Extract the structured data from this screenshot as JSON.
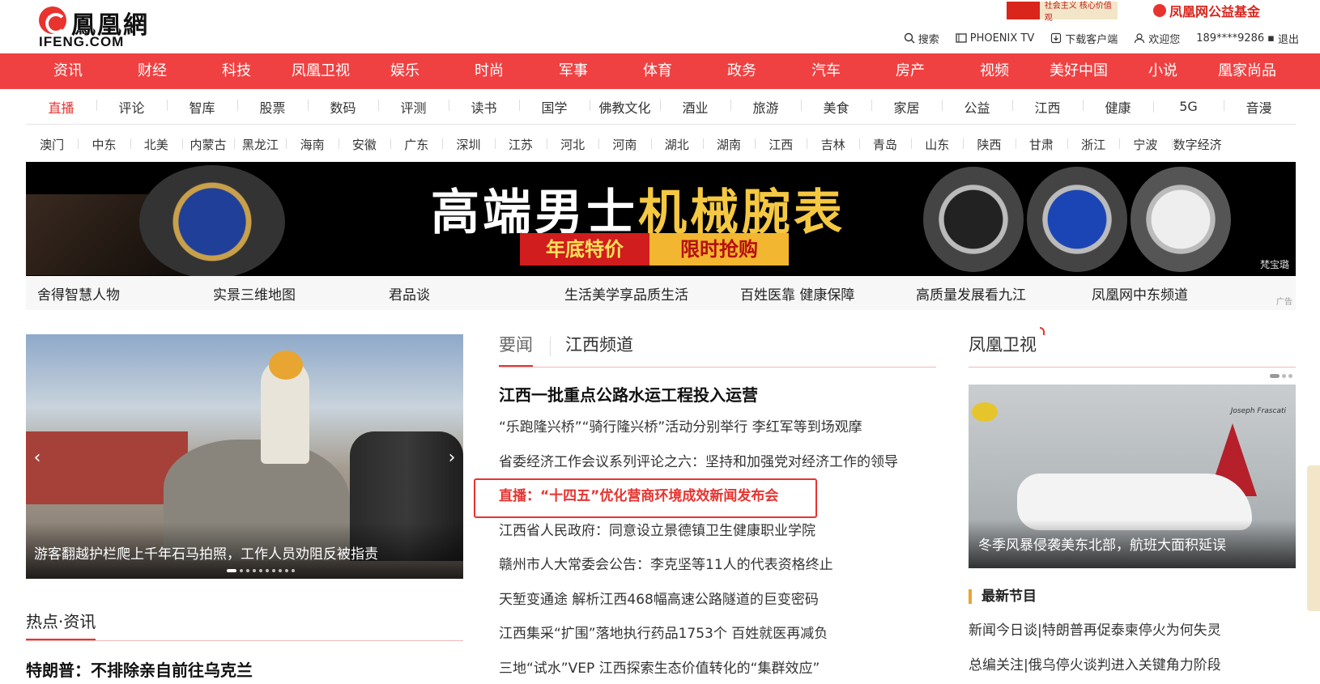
{
  "header": {
    "logo_cn": "鳳凰網",
    "logo_en": "IFENG.COM",
    "promo_left": "社会主义 核心价值观",
    "promo_right": "凤凰网公益基金",
    "toolbar": {
      "search": "搜索",
      "phoenix_tv": "PHOENIX TV",
      "download": "下载客户端",
      "welcome": "欢迎您",
      "user": "189****9286",
      "logout": "退出"
    }
  },
  "nav_main": [
    "资讯",
    "财经",
    "科技",
    "凤凰卫视",
    "娱乐",
    "时尚",
    "军事",
    "体育",
    "政务",
    "汽车",
    "房产",
    "视频",
    "美好中国",
    "小说",
    "凰家尚品"
  ],
  "nav_sub1": [
    "直播",
    "评论",
    "智库",
    "股票",
    "数码",
    "评测",
    "读书",
    "国学",
    "佛教文化",
    "酒业",
    "旅游",
    "美食",
    "家居",
    "公益",
    "江西",
    "健康",
    "5G",
    "音漫"
  ],
  "nav_sub2": [
    "澳门",
    "中东",
    "北美",
    "内蒙古",
    "黑龙江",
    "海南",
    "安徽",
    "广东",
    "深圳",
    "江苏",
    "河北",
    "河南",
    "湖北",
    "湖南",
    "江西",
    "吉林",
    "青岛",
    "山东",
    "陕西",
    "甘肃",
    "浙江",
    "宁波",
    "数字经济"
  ],
  "ad_banner": {
    "headline_white": "高端男士",
    "headline_gold": "机械腕表",
    "tag1": "年底特价",
    "tag2": "限时抢购",
    "brand": "梵宝璐"
  },
  "ad_links": [
    "舍得智慧人物",
    "实景三维地图",
    "君品谈",
    "生活美学享品质生活",
    "百姓医靠 健康保障",
    "高质量发展看九江",
    "凤凰网中东频道"
  ],
  "ad_mark": "广告",
  "carousel": {
    "caption": "游客翻越护栏爬上千年石马拍照，工作人员劝阻反被指责",
    "arrow_left": "‹",
    "arrow_right": "›"
  },
  "hot": {
    "title": "热点·资讯",
    "headline": "特朗普：不排除亲自前往乌克兰"
  },
  "middle": {
    "tabs": [
      "要闻",
      "江西频道"
    ],
    "lead": "江西一批重点公路水运工程投入运营",
    "items": [
      "“乐跑隆兴桥”“骑行隆兴桥”活动分别举行 李红军等到场观摩",
      "省委经济工作会议系列评论之六：坚持和加强党对经济工作的领导",
      "直播：“十四五”优化营商环境成效新闻发布会",
      "江西省人民政府：同意设立景德镇卫生健康职业学院",
      "赣州市人大常委会公告：李克坚等11人的代表资格终止",
      "天堑变通途 解析江西468幅高速公路隧道的巨变密码",
      "江西集采“扩围”落地执行药品1753个 百姓就医再减负",
      "三地“试水”VEP 江西探索生态价值转化的“集群效应”"
    ]
  },
  "right": {
    "title": "凤凰卫视",
    "card_caption": "冬季风暴侵袭美东北部，航班大面积延误",
    "card_credit": "Joseph Frascati",
    "latest_title": "最新节目",
    "items": [
      "新闻今日谈|特朗普再促泰柬停火为何失灵",
      "总编关注|俄乌停火谈判进入关键角力阶段"
    ]
  }
}
